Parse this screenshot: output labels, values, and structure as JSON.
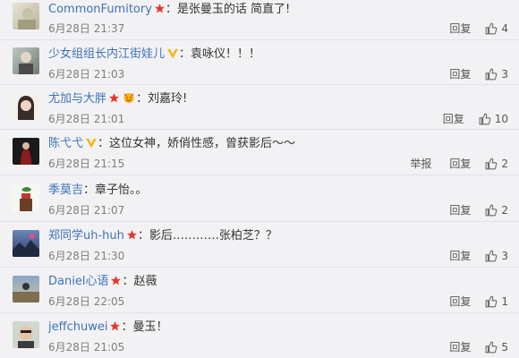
{
  "comments": [
    {
      "user": "CommonFumitory",
      "badge": "star",
      "text": "：是张曼玉的话 简直了!",
      "time": "6月28日 21:37",
      "reply": "回复",
      "report": "",
      "likes": "4"
    },
    {
      "user": "少女组组长内江街娃儿",
      "badge": "v",
      "text": "：袁咏仪！！！",
      "time": "6月28日 21:03",
      "reply": "回复",
      "report": "",
      "likes": "3"
    },
    {
      "user": "尤加与大胖",
      "badge": "star-face",
      "text": "：刘嘉玲!",
      "time": "6月28日 21:01",
      "reply": "回复",
      "report": "",
      "likes": "10"
    },
    {
      "user": "陈弋弋",
      "badge": "v",
      "text": "：这位女神，娇俏性感，曾获影后～～",
      "time": "6月28日 21:15",
      "reply": "回复",
      "report": "举报",
      "likes": "2"
    },
    {
      "user": "季莫吉",
      "badge": "",
      "text": "：章子怡。。",
      "time": "6月28日 21:07",
      "reply": "回复",
      "report": "",
      "likes": "2"
    },
    {
      "user": "郑同学uh-huh",
      "badge": "star",
      "text": "：影后…………张柏芝？？",
      "time": "6月28日 21:30",
      "reply": "回复",
      "report": "",
      "likes": "3"
    },
    {
      "user": "Daniel心语",
      "badge": "star",
      "text": "：赵薇",
      "time": "6月28日 22:05",
      "reply": "回复",
      "report": "",
      "likes": "1"
    },
    {
      "user": "jeffchuwei",
      "badge": "star",
      "text": "：曼玉！",
      "time": "6月28日 21:05",
      "reply": "回复",
      "report": "",
      "likes": "5"
    }
  ],
  "colors": {
    "link": "#3d73b6",
    "star": "#e8372d",
    "v": "#f5b50a"
  }
}
